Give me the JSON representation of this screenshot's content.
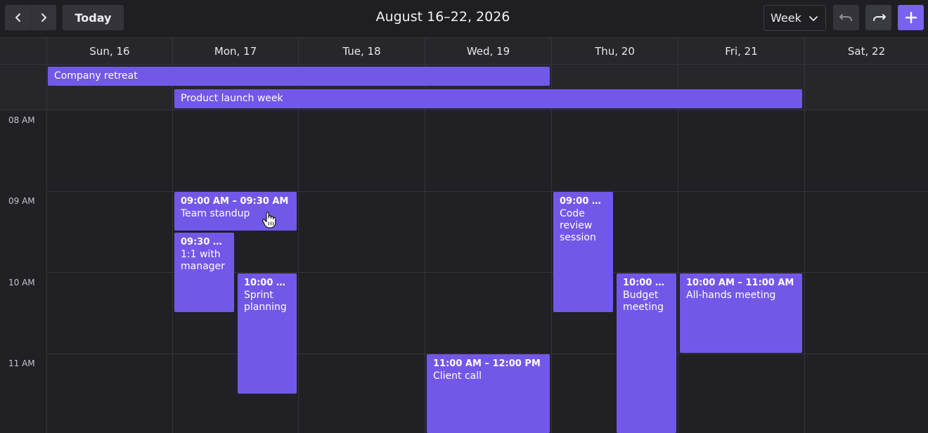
{
  "toolbar": {
    "prev_icon": "chevron-left-icon",
    "next_icon": "chevron-right-icon",
    "today_label": "Today",
    "title": "August 16–22, 2026",
    "view_value": "Week",
    "undo_icon": "undo-icon",
    "redo_icon": "redo-icon",
    "add_icon": "plus-icon"
  },
  "days": [
    "Sun, 16",
    "Mon, 17",
    "Tue, 18",
    "Wed, 19",
    "Thu, 20",
    "Fri, 21",
    "Sat, 22"
  ],
  "all_day_events": [
    {
      "title": "Company retreat"
    },
    {
      "title": "Product launch week"
    }
  ],
  "time_labels": [
    "08 AM",
    "09 AM",
    "10 AM",
    "11 AM"
  ],
  "events": [
    {
      "time": "09:00 AM – 09:30 AM",
      "title": "Team standup"
    },
    {
      "time": "09:30 A...",
      "title": "1:1 with manager"
    },
    {
      "time": "10:00 A...",
      "title": "Sprint planning"
    },
    {
      "time": "09:00 A...",
      "title": "Code review session"
    },
    {
      "time": "10:00 A...",
      "title": "Budget meeting"
    },
    {
      "time": "10:00 AM – 11:00 AM",
      "title": "All-hands meeting"
    },
    {
      "time": "11:00 AM – 12:00 PM",
      "title": "Client call"
    }
  ],
  "colors": {
    "accent": "#7258e8",
    "background": "#1f1f23",
    "grid_line": "#34343a"
  }
}
